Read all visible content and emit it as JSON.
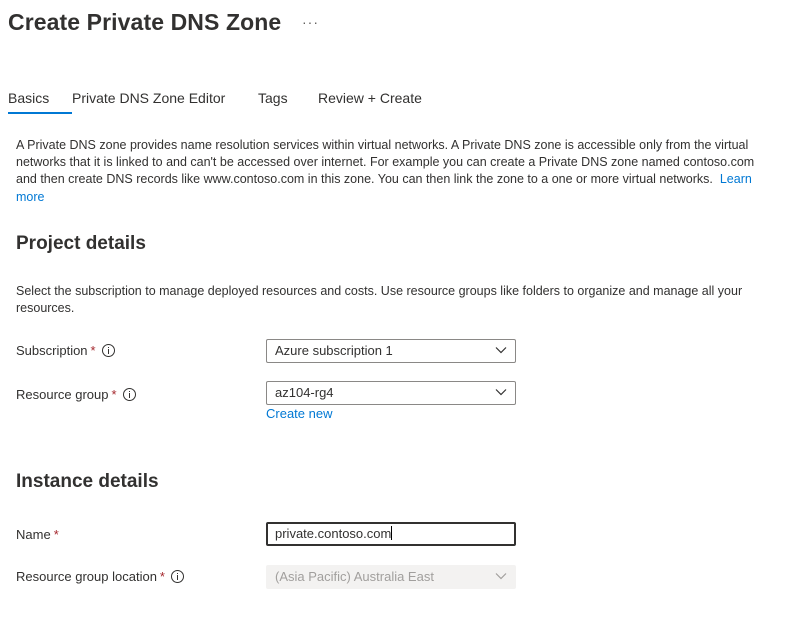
{
  "header": {
    "title": "Create Private DNS Zone",
    "more_label": "···"
  },
  "tabs": [
    {
      "label": "Basics",
      "active": true
    },
    {
      "label": "Private DNS Zone Editor",
      "active": false
    },
    {
      "label": "Tags",
      "active": false
    },
    {
      "label": "Review + Create",
      "active": false
    }
  ],
  "intro": {
    "text": "A Private DNS zone provides name resolution services within virtual networks. A Private DNS zone is accessible only from the virtual networks that it is linked to and can't be accessed over internet. For example you can create a Private DNS zone named contoso.com and then create DNS records like www.contoso.com in this zone. You can then link the zone to a one or more virtual networks.",
    "learn_more": "Learn more"
  },
  "project_details": {
    "heading": "Project details",
    "description": "Select the subscription to manage deployed resources and costs. Use resource groups like folders to organize and manage all your resources.",
    "subscription": {
      "label": "Subscription",
      "required": "*",
      "value": "Azure subscription 1"
    },
    "resource_group": {
      "label": "Resource group",
      "required": "*",
      "value": "az104-rg4",
      "create_new": "Create new"
    }
  },
  "instance_details": {
    "heading": "Instance details",
    "name": {
      "label": "Name",
      "required": "*",
      "value": "private.contoso.com"
    },
    "location": {
      "label": "Resource group location",
      "required": "*",
      "value": "(Asia Pacific) Australia East",
      "disabled": true
    }
  },
  "colors": {
    "accent": "#0078d4",
    "required": "#a4262c",
    "text": "#323130",
    "disabled_bg": "#f3f2f1"
  }
}
